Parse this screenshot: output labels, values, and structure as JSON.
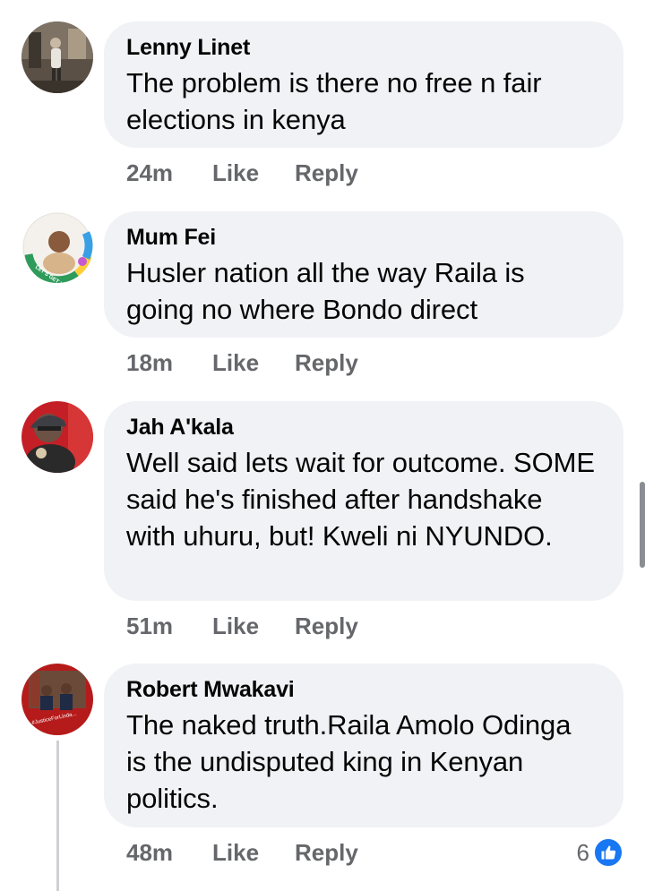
{
  "comments": [
    {
      "author": "Lenny Linet",
      "text": "The problem is there no free n fair elections in kenya",
      "time": "24m",
      "like": "Like",
      "reply": "Reply",
      "avatar_icon": "person-photo-avatar"
    },
    {
      "author": "Mum Fei",
      "text": "Husler nation all the way Raila is going no where Bondo direct",
      "time": "18m",
      "like": "Like",
      "reply": "Reply",
      "avatar_icon": "vaccinated-frame-avatar",
      "avatar_badge_text": "LET'S GET VACCINATED"
    },
    {
      "author": "Jah A'kala",
      "text": "Well said lets wait for outcome. SOME said he's finished after handshake with uhuru, but! Kweli ni NYUNDO.",
      "time": "51m",
      "like": "Like",
      "reply": "Reply",
      "avatar_icon": "person-cap-avatar"
    },
    {
      "author": "Robert Mwakavi",
      "text": "The naked truth.Raila Amolo Odinga is the undisputed king in Kenyan politics.",
      "time": "48m",
      "like": "Like",
      "reply": "Reply",
      "reaction_count": "6",
      "reaction_icon": "thumbs-up-icon",
      "avatar_icon": "justice-frame-avatar",
      "avatar_badge_text": "#JusticeForLinda..."
    }
  ],
  "colors": {
    "bubble": "#f0f2f5",
    "meta": "#65676b",
    "like_blue": "#1877f2"
  }
}
